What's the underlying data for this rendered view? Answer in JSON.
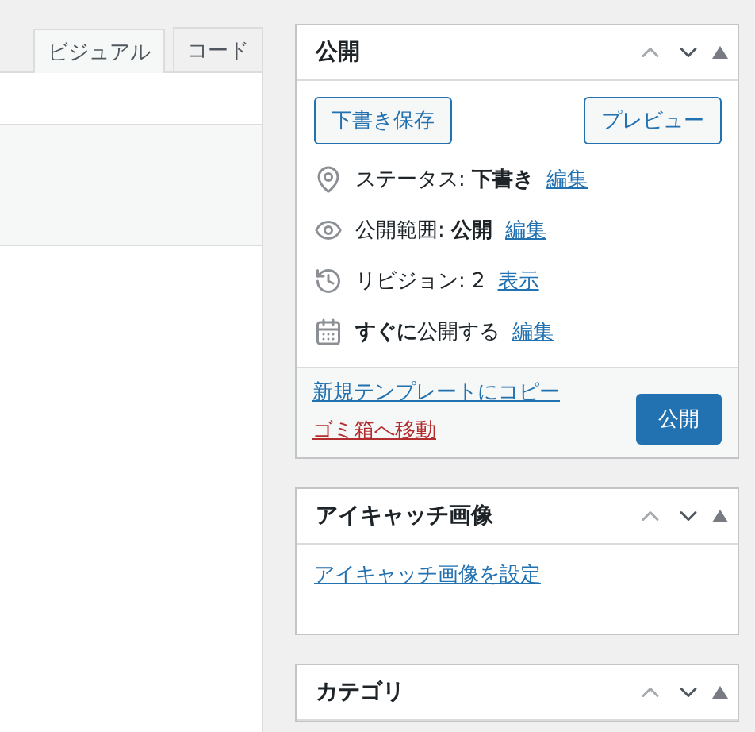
{
  "editor": {
    "tabs": [
      {
        "label": "ビジュアル",
        "selected": true
      },
      {
        "label": "コード",
        "selected": false
      }
    ]
  },
  "sidebar": [
    {
      "title": "公開",
      "buttons": [
        {
          "label": "下書き保存"
        },
        {
          "label": "プレビュー"
        }
      ],
      "rows": [
        {
          "kind": "status",
          "text": "ステータス: **下書き**",
          "link": "編集"
        },
        {
          "kind": "visibility",
          "text": "公開範囲: **公開**",
          "link": "編集"
        },
        {
          "kind": "revisions",
          "text": "リビジョン: 2",
          "link": "表示"
        },
        {
          "kind": "schedule",
          "text": "**すぐに**公開する",
          "link": "編集"
        }
      ],
      "footer": {
        "links": [
          {
            "label": "新規テンプレートにコピー",
            "kind": "normal"
          },
          {
            "label": "ゴミ箱へ移動",
            "kind": "danger"
          }
        ],
        "primary": "公開"
      }
    },
    {
      "title": "アイキャッチ画像",
      "link": "アイキャッチ画像を設定"
    },
    {
      "title": "カテゴリ"
    }
  ]
}
